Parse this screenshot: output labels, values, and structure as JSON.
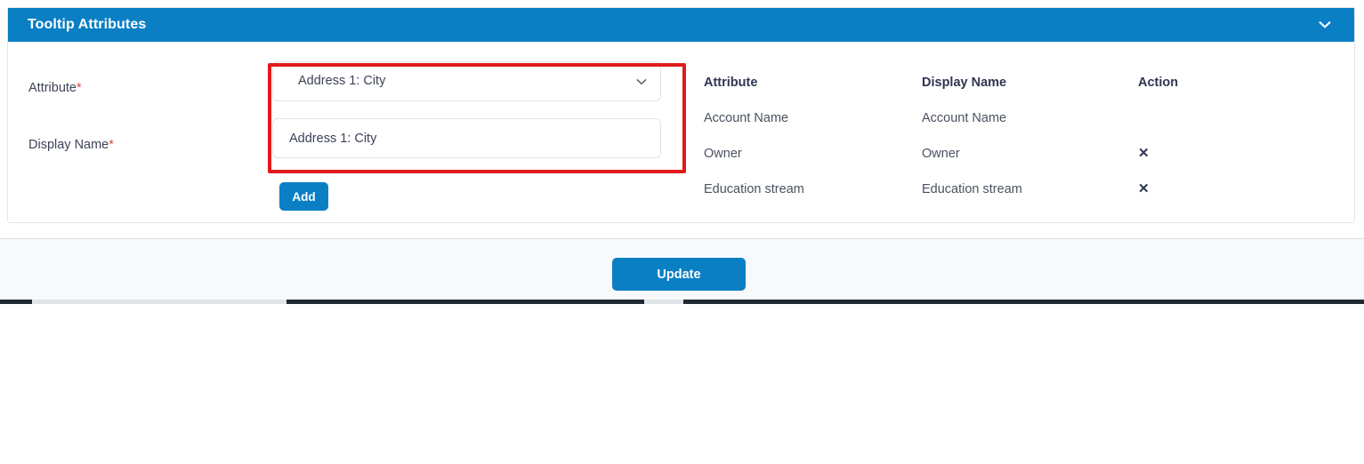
{
  "card": {
    "title": "Tooltip Attributes",
    "collapse_icon": "chevron-down-icon",
    "header_color": "#0b7fc4"
  },
  "form": {
    "attribute": {
      "label": "Attribute",
      "required_marker": "*",
      "selected_value": "Address 1: City",
      "caret_icon": "chevron-down-icon"
    },
    "display_name": {
      "label": "Display Name",
      "required_marker": "*",
      "value": "Address 1: City",
      "placeholder": "Display Name"
    },
    "add_button": "Add"
  },
  "annotation": {
    "color": "#e01b1b"
  },
  "table": {
    "columns": [
      "Attribute",
      "Display Name",
      "Action"
    ],
    "rows": [
      {
        "attribute": "Account Name",
        "display_name": "Account Name",
        "action": ""
      },
      {
        "attribute": "Owner",
        "display_name": "Owner",
        "action": "✕"
      },
      {
        "attribute": "Education stream",
        "display_name": "Education stream",
        "action": "✕"
      }
    ]
  },
  "footer": {
    "update_button": "Update"
  }
}
